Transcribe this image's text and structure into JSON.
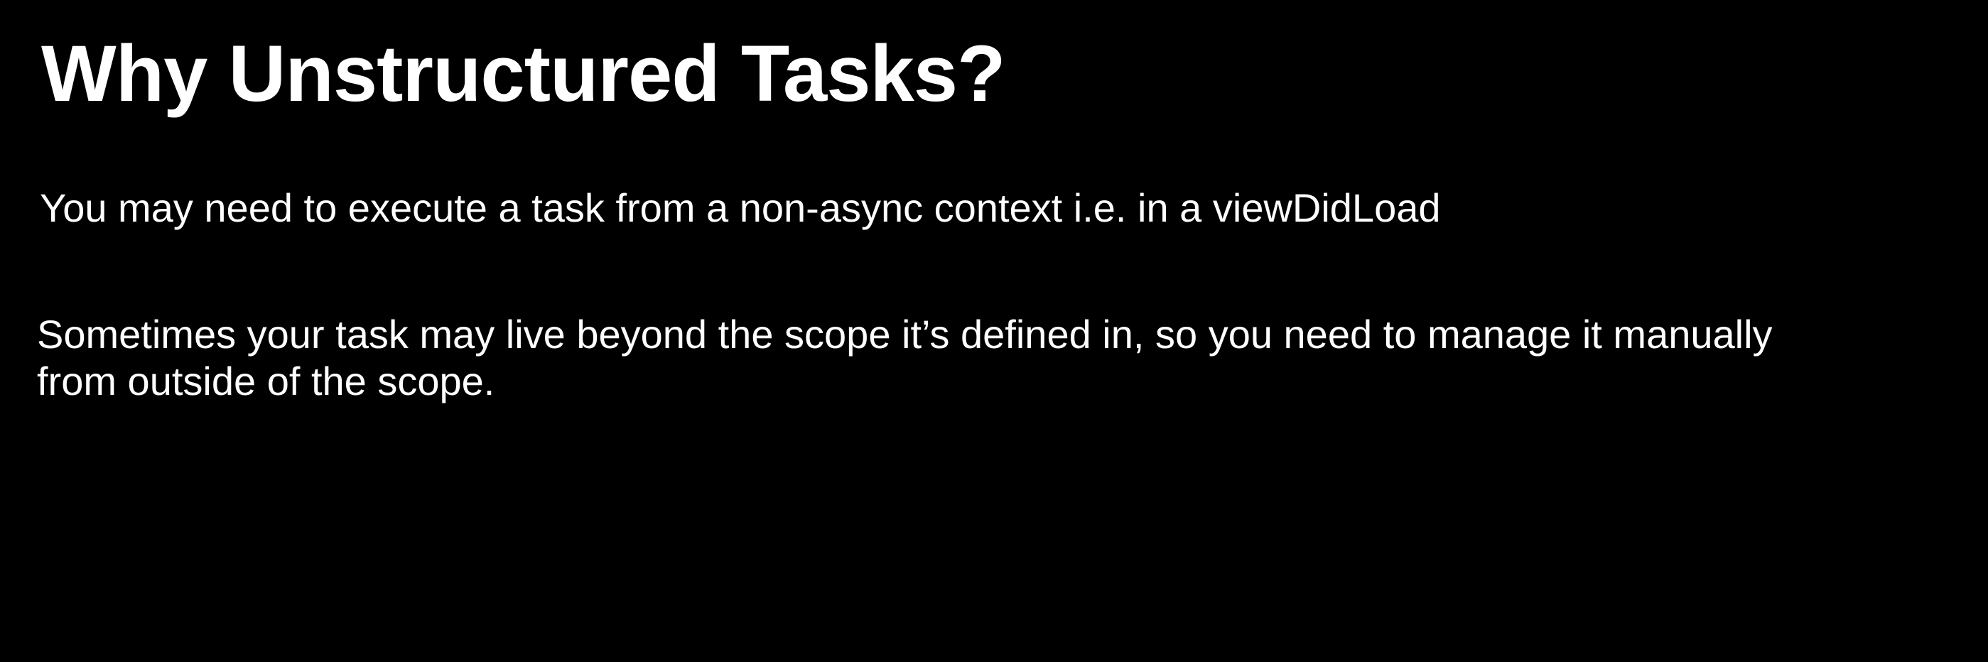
{
  "slide": {
    "title": "Why Unstructured Tasks?",
    "points": [
      "You may need to execute a task from a non-async context i.e. in a viewDidLoad",
      "Sometimes your task may live beyond the scope it’s defined in, so you need to manage it manually from outside of the scope."
    ]
  },
  "colors": {
    "background": "#000000",
    "text": "#ffffff"
  }
}
